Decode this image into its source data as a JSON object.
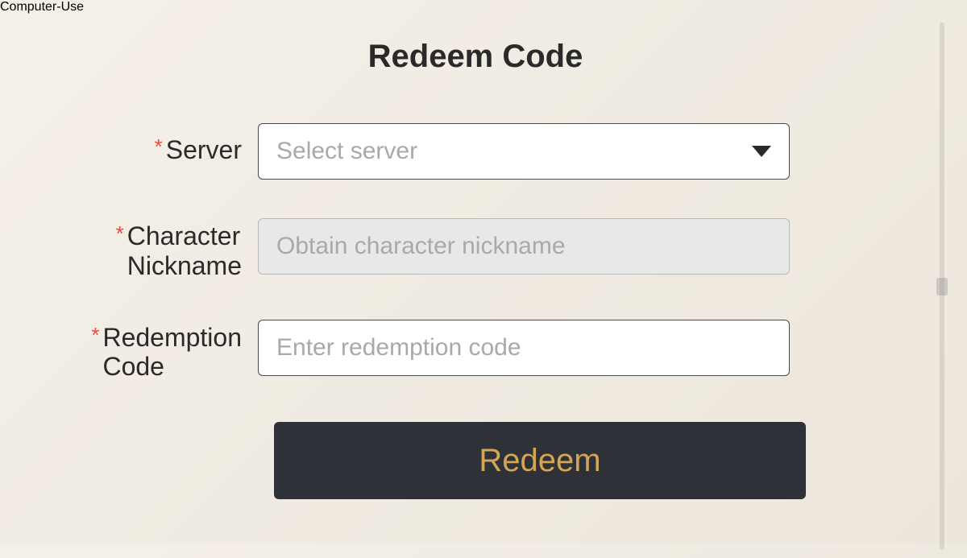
{
  "title": "Redeem Code",
  "fields": {
    "server": {
      "label": "Server",
      "placeholder": "Select server",
      "required": true
    },
    "nickname": {
      "label_line1": "Character",
      "label_line2": "Nickname",
      "placeholder": "Obtain character nickname",
      "required": true
    },
    "redemption": {
      "label_line1": "Redemption",
      "label_line2": "Code",
      "placeholder": "Enter redemption code",
      "required": true
    }
  },
  "button": {
    "label": "Redeem"
  },
  "required_mark": "*"
}
